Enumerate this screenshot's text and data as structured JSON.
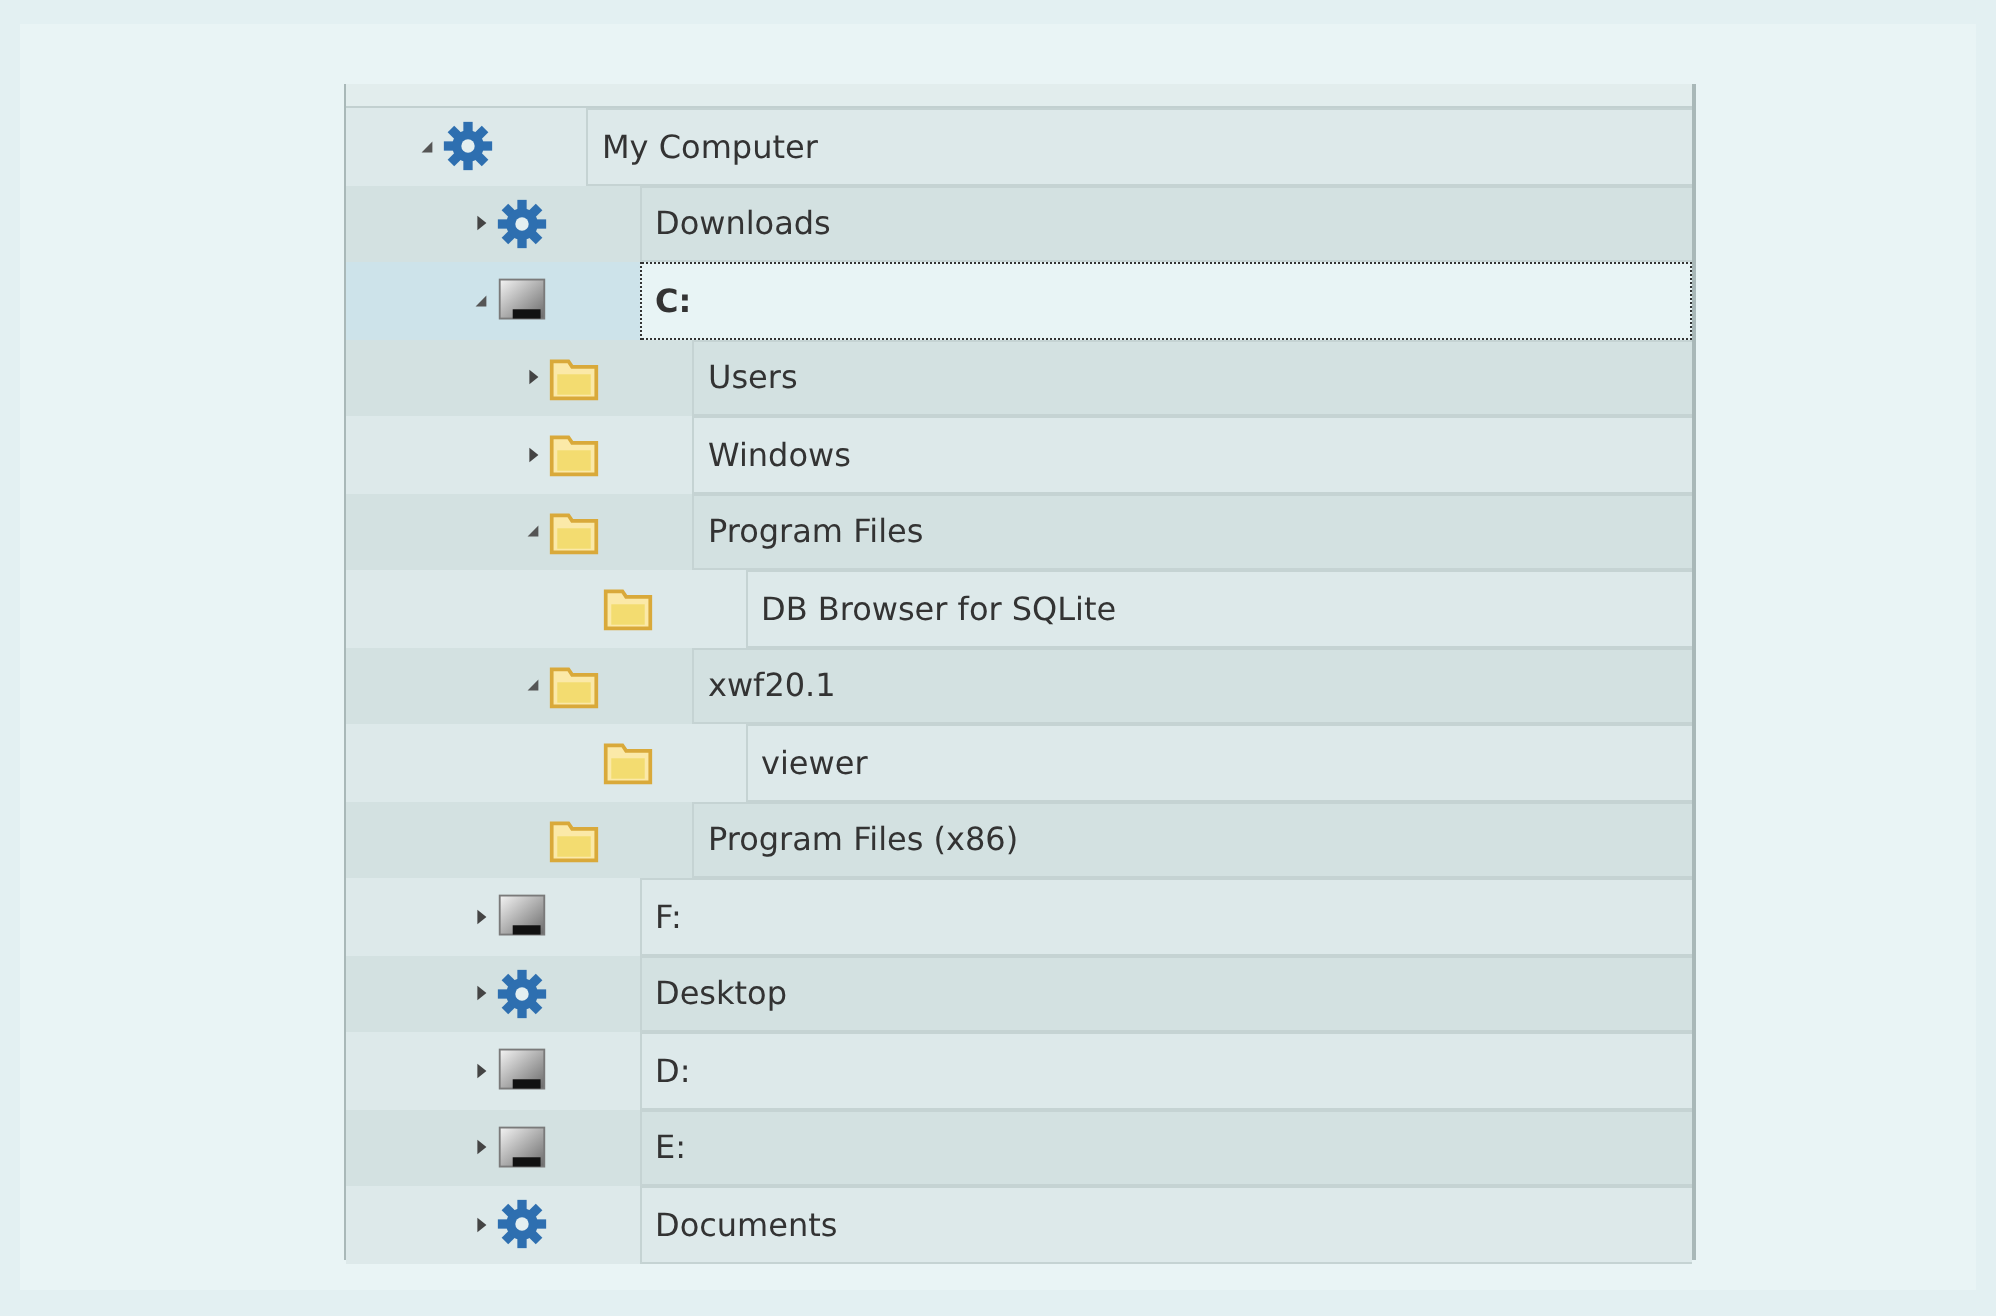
{
  "tree": [
    {
      "label": "My Computer",
      "kind": "gear",
      "expanded": true,
      "selected": false,
      "children": [
        {
          "label": "Downloads",
          "kind": "gear",
          "expanded": false,
          "selected": false
        },
        {
          "label": "C:",
          "kind": "drive",
          "expanded": true,
          "selected": true,
          "children": [
            {
              "label": "Users",
              "kind": "folder",
              "expanded": false,
              "selected": false
            },
            {
              "label": "Windows",
              "kind": "folder",
              "expanded": false,
              "selected": false
            },
            {
              "label": "Program Files",
              "kind": "folder",
              "expanded": true,
              "selected": false,
              "children": [
                {
                  "label": "DB Browser for SQLite",
                  "kind": "folder",
                  "selected": false
                }
              ]
            },
            {
              "label": "xwf20.1",
              "kind": "folder",
              "expanded": true,
              "selected": false,
              "children": [
                {
                  "label": "viewer",
                  "kind": "folder",
                  "selected": false
                }
              ]
            },
            {
              "label": "Program Files (x86)",
              "kind": "folder",
              "selected": false
            }
          ]
        },
        {
          "label": "F:",
          "kind": "drive",
          "expanded": false,
          "selected": false
        },
        {
          "label": "Desktop",
          "kind": "gear",
          "expanded": false,
          "selected": false
        },
        {
          "label": "D:",
          "kind": "drive",
          "expanded": false,
          "selected": false
        },
        {
          "label": "E:",
          "kind": "drive",
          "expanded": false,
          "selected": false
        },
        {
          "label": "Documents",
          "kind": "gear",
          "expanded": false,
          "selected": false
        }
      ]
    }
  ]
}
